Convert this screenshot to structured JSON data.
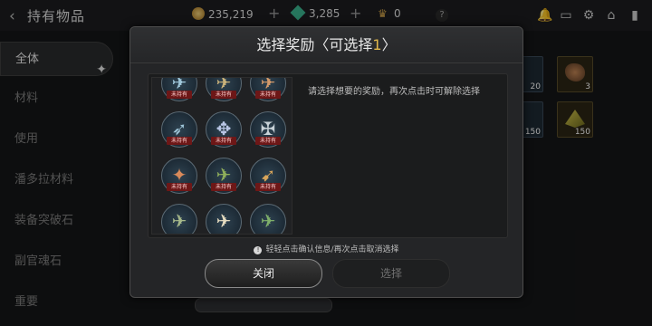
{
  "header": {
    "title": "持有物品",
    "gold": "235,219",
    "gems": "3,285",
    "crowns": "0"
  },
  "sidebar": {
    "items": [
      {
        "label": "全体",
        "active": true
      },
      {
        "label": "材料"
      },
      {
        "label": "使用"
      },
      {
        "label": "潘多拉材料"
      },
      {
        "label": "装备突破石"
      },
      {
        "label": "副官魂石"
      },
      {
        "label": "重要"
      }
    ]
  },
  "background_slots": [
    "20",
    "3",
    "150",
    "150"
  ],
  "modal": {
    "title_prefix": "选择奖励〈可选择",
    "title_count": "1",
    "title_suffix": "〉",
    "description": "请选择想要的奖励，再次点击时可解除选择",
    "not_owned_tag": "未持有",
    "hint": "轻轻点击确认信息/再次点击取消选择",
    "close_label": "关闭",
    "select_label": "选择"
  },
  "colors": {
    "accent_gold": "#e2b84b",
    "tag_red": "#6d1717"
  }
}
